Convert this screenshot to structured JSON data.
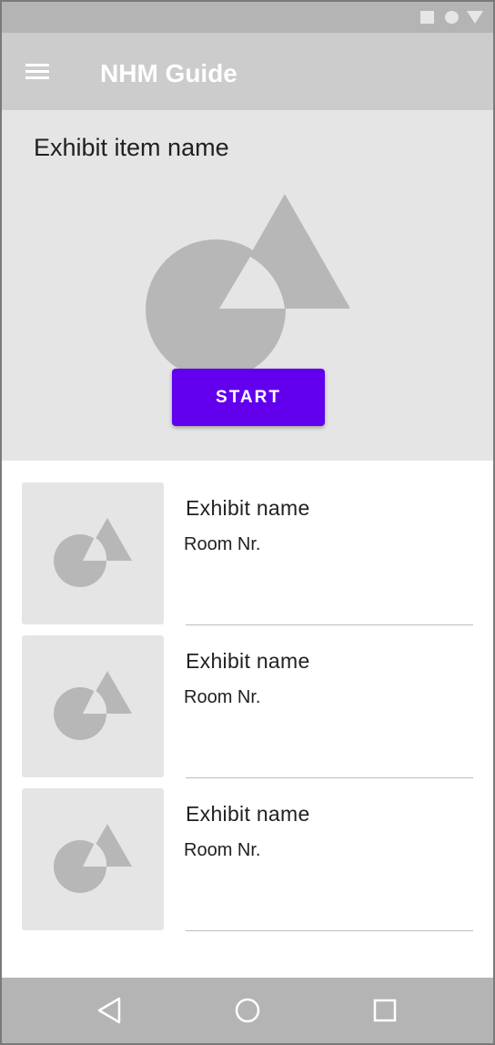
{
  "status_bar": {
    "icons": [
      "square-icon",
      "circle-icon",
      "triangle-down-icon"
    ],
    "color": "#b4b4b4"
  },
  "app_bar": {
    "title": "NHM Guide",
    "menu_icon": "menu-icon",
    "color": "#cccccc"
  },
  "hero": {
    "title": "Exhibit item name",
    "image_icon": "image-placeholder-icon",
    "start_label": "START",
    "button_color": "#6200ee"
  },
  "exhibits": [
    {
      "name": "Exhibit name",
      "room": "Room Nr."
    },
    {
      "name": "Exhibit name",
      "room": "Room Nr."
    },
    {
      "name": "Exhibit name",
      "room": "Room Nr."
    }
  ],
  "nav_bar": {
    "icons": [
      "back-icon",
      "home-icon",
      "recents-icon"
    ],
    "color": "#b4b4b4"
  }
}
